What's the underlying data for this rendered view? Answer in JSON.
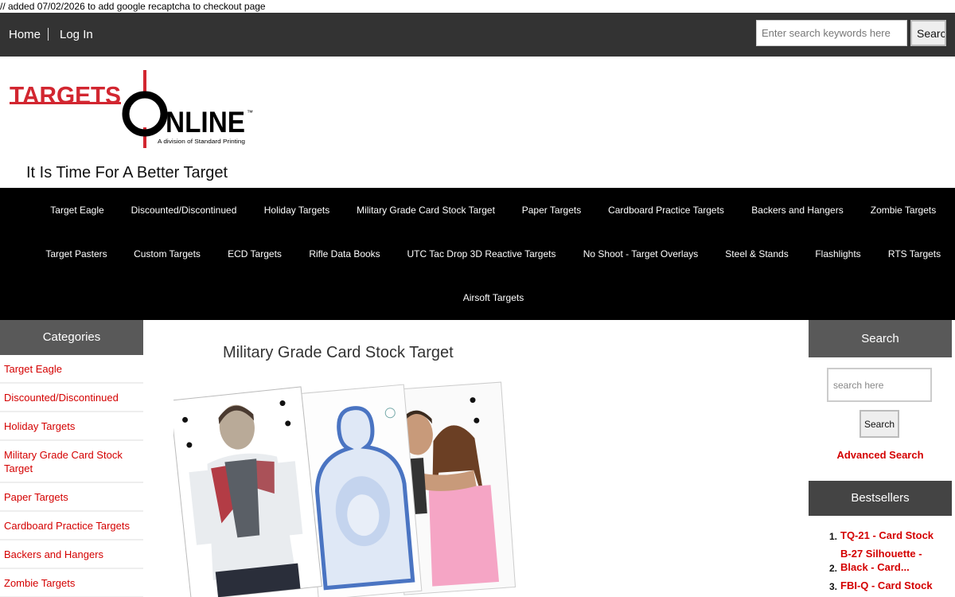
{
  "dev_note": "// added 07/02/2026 to add google recaptcha to checkout page",
  "topbar": {
    "home": "Home",
    "login": "Log In",
    "search_placeholder": "Enter search keywords here",
    "search_button": "Search"
  },
  "brand": {
    "logo_word_1": "TARGETS",
    "logo_word_2": "NLINE",
    "logo_tm": "™",
    "logo_subtitle": "A division of Standard Printing",
    "tagline": "It Is Time For A Better Target",
    "colors": {
      "red": "#d22630",
      "black": "#000000"
    }
  },
  "mainnav": [
    "Target Eagle",
    "Discounted/Discontinued",
    "Holiday Targets",
    "Military Grade Card Stock Target",
    "Paper Targets",
    "Cardboard Practice Targets",
    "Backers and Hangers",
    "Zombie Targets",
    "Target Pasters",
    "Custom Targets",
    "ECD Targets",
    "Rifle Data Books",
    "UTC Tac Drop 3D Reactive Targets",
    "No Shoot - Target Overlays",
    "Steel & Stands",
    "Flashlights",
    "RTS Targets",
    "Airsoft Targets"
  ],
  "categories": {
    "header": "Categories",
    "items": [
      "Target Eagle",
      "Discounted/Discontinued",
      "Holiday Targets",
      "Military Grade Card Stock Target",
      "Paper Targets",
      "Cardboard Practice Targets",
      "Backers and Hangers",
      "Zombie Targets"
    ]
  },
  "main": {
    "title": "Military Grade Card Stock Target"
  },
  "sidebar": {
    "search_header": "Search",
    "search_placeholder": "search here",
    "search_button": "Search",
    "advanced_search": "Advanced Search",
    "bestsellers_header": "Bestsellers",
    "bestsellers": [
      {
        "num": "1.",
        "label": "TQ-21 - Card Stock"
      },
      {
        "num": "2.",
        "label": "B-27 Silhouette - Black - Card..."
      },
      {
        "num": "3.",
        "label": "FBI-Q - Card Stock"
      }
    ]
  },
  "colors": {
    "link_red": "#d40000",
    "topbar": "#333333",
    "nav_bg": "#000000",
    "side_header": "#595959"
  }
}
